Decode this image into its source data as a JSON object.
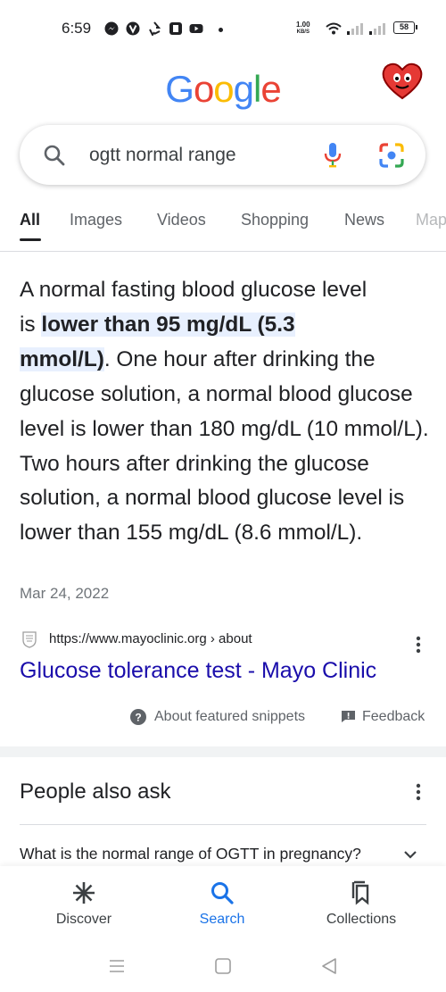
{
  "status_bar": {
    "time": "6:59",
    "net_speed_value": "1.00",
    "net_speed_unit": "KB/S",
    "battery": "58",
    "icons": [
      "messenger-icon",
      "vpn-icon",
      "recycle-icon",
      "photo-app-icon",
      "youtube-icon",
      "more-notifications-dot",
      "wifi-icon",
      "signal-icon",
      "signal-icon",
      "battery-icon"
    ]
  },
  "header": {
    "logo_letters": [
      "G",
      "o",
      "o",
      "g",
      "l",
      "e"
    ],
    "logo_colors": [
      "#4285F4",
      "#EA4335",
      "#FBBC05",
      "#4285F4",
      "#34A853",
      "#EA4335"
    ]
  },
  "search": {
    "query": "ogtt normal range",
    "icons": [
      "search-icon",
      "mic-icon",
      "lens-icon"
    ]
  },
  "tabs": [
    {
      "label": "All",
      "active": true
    },
    {
      "label": "Images"
    },
    {
      "label": "Videos"
    },
    {
      "label": "Shopping"
    },
    {
      "label": "News"
    },
    {
      "label": "Map"
    }
  ],
  "featured_snippet": {
    "line1": "A normal fasting blood glucose level",
    "line2_pre": "is ",
    "highlight_part1": "lower than 95 mg/dL (5.3",
    "highlight_part2": "mmol/L)",
    "after_highlight": ". One hour after drinking the glucose solution, a normal blood glucose level is lower than 180 mg/dL (10 mmol/L). Two hours after drinking the glucose solution, a normal blood glucose level is lower than 155 mg/dL (8.6 mmol/L).",
    "date": "Mar 24, 2022",
    "source_url": "https://www.mayoclinic.org › about",
    "result_title": "Glucose tolerance test - Mayo Clinic",
    "about_label": "About featured snippets",
    "feedback_label": "Feedback"
  },
  "people_also_ask": {
    "title": "People also ask",
    "questions": [
      "What is the normal range of OGTT in pregnancy?"
    ]
  },
  "bottom_nav": [
    {
      "label": "Discover",
      "icon": "asterisk-icon"
    },
    {
      "label": "Search",
      "icon": "search-icon",
      "active": true
    },
    {
      "label": "Collections",
      "icon": "bookmark-stack-icon"
    }
  ],
  "colors": {
    "accent": "#1a73e8",
    "link": "#1a0dab",
    "highlight_bg": "#e8f0fe"
  }
}
